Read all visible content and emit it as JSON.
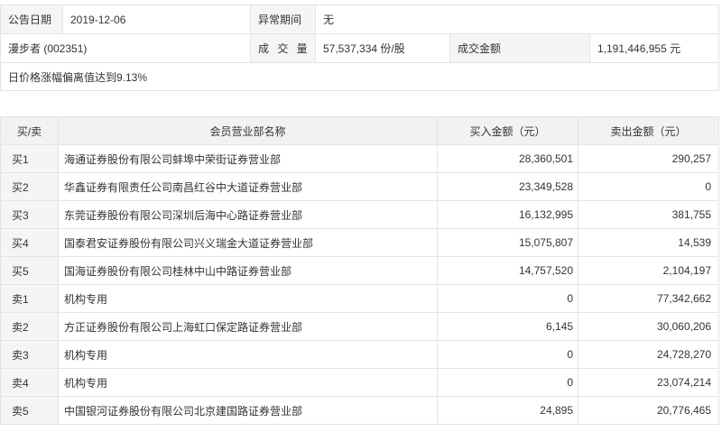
{
  "info": {
    "date_label": "公告日期",
    "date_value": "2019-12-06",
    "period_label": "异常期间",
    "period_value": "无",
    "stock_name": "漫步者 (002351)",
    "volume_label": "成 交 量",
    "volume_value": "57,537,334 份/股",
    "turnover_label": "成交金额",
    "turnover_value": "1,191,446,955 元",
    "reason": "日价格涨幅偏离值达到9.13%"
  },
  "table": {
    "headers": {
      "side": "买/卖",
      "name": "会员营业部名称",
      "buy": "买入金额（元）",
      "sell": "卖出金额（元）"
    },
    "rows": [
      {
        "side": "买1",
        "name": "海通证券股份有限公司蚌埠中荣街证券营业部",
        "buy": "28,360,501",
        "sell": "290,257"
      },
      {
        "side": "买2",
        "name": "华鑫证券有限责任公司南昌红谷中大道证券营业部",
        "buy": "23,349,528",
        "sell": "0"
      },
      {
        "side": "买3",
        "name": "东莞证券股份有限公司深圳后海中心路证券营业部",
        "buy": "16,132,995",
        "sell": "381,755"
      },
      {
        "side": "买4",
        "name": "国泰君安证券股份有限公司兴义瑞金大道证券营业部",
        "buy": "15,075,807",
        "sell": "14,539"
      },
      {
        "side": "买5",
        "name": "国海证券股份有限公司桂林中山中路证券营业部",
        "buy": "14,757,520",
        "sell": "2,104,197"
      },
      {
        "side": "卖1",
        "name": "机构专用",
        "buy": "0",
        "sell": "77,342,662"
      },
      {
        "side": "卖2",
        "name": "方正证券股份有限公司上海虹口保定路证券营业部",
        "buy": "6,145",
        "sell": "30,060,206"
      },
      {
        "side": "卖3",
        "name": "机构专用",
        "buy": "0",
        "sell": "24,728,270"
      },
      {
        "side": "卖4",
        "name": "机构专用",
        "buy": "0",
        "sell": "23,074,214"
      },
      {
        "side": "卖5",
        "name": "中国银河证券股份有限公司北京建国路证券营业部",
        "buy": "24,895",
        "sell": "20,776,465"
      }
    ]
  }
}
